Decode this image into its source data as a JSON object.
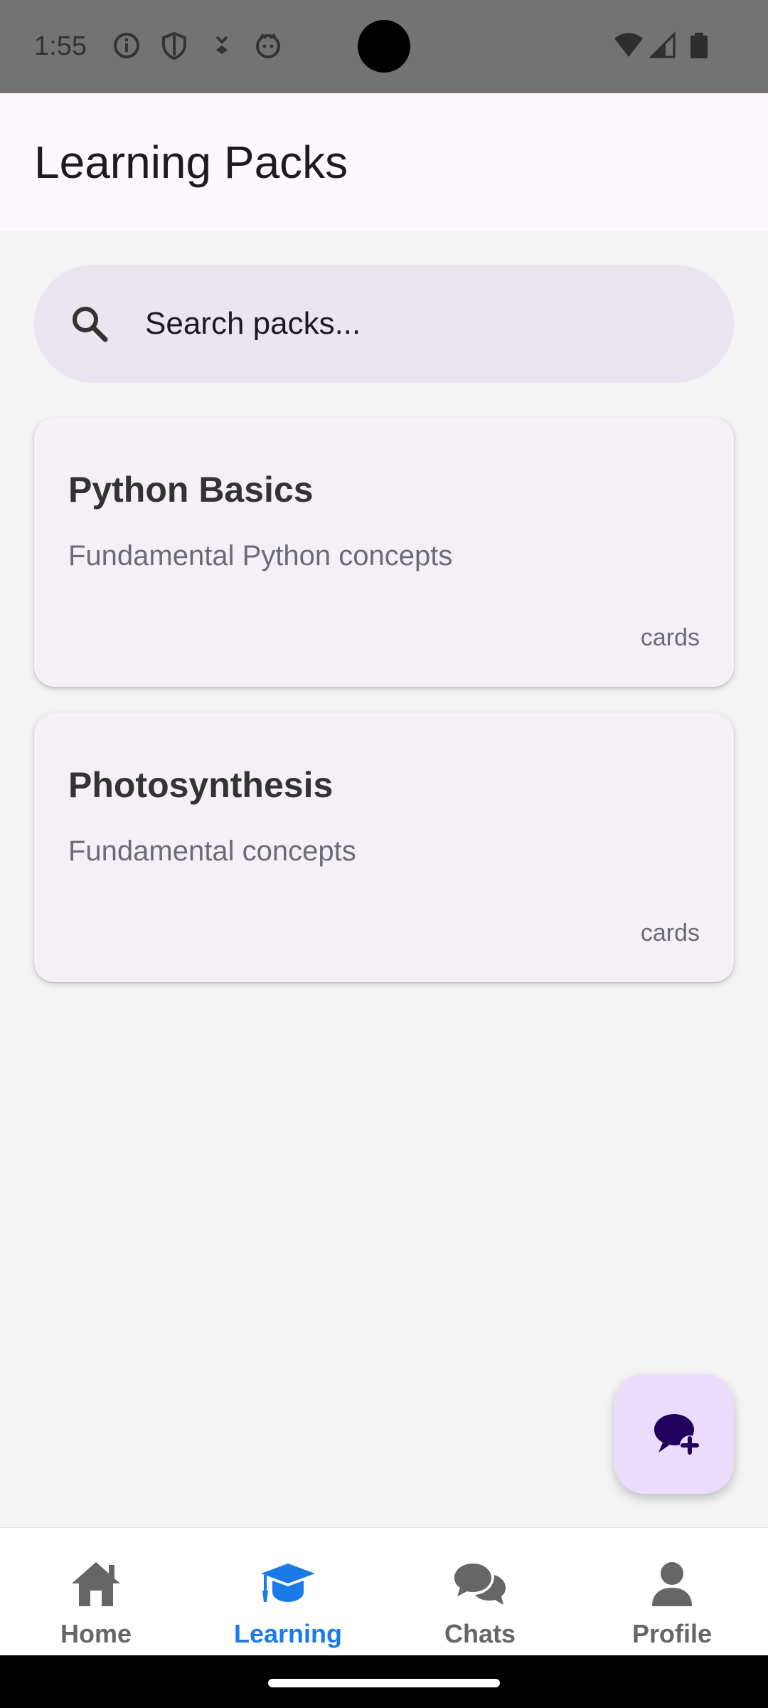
{
  "status_bar": {
    "time": "1:55",
    "left_icons": [
      "info-icon",
      "shield-icon",
      "download-icon",
      "cat-icon"
    ],
    "right_icons": [
      "wifi-icon",
      "signal-icon",
      "battery-icon"
    ]
  },
  "app_bar": {
    "title": "Learning Packs"
  },
  "search": {
    "placeholder": "Search packs...",
    "value": ""
  },
  "packs": [
    {
      "title": "Python Basics",
      "description": "Fundamental Python concepts",
      "count": "cards"
    },
    {
      "title": "Photosynthesis",
      "description": "Fundamental concepts",
      "count": "cards"
    }
  ],
  "fab": {
    "icon": "new-chat-icon"
  },
  "bottom_nav": {
    "items": [
      {
        "label": "Home",
        "icon": "home-icon",
        "active": false
      },
      {
        "label": "Learning",
        "icon": "graduation-cap-icon",
        "active": true
      },
      {
        "label": "Chats",
        "icon": "chat-bubbles-icon",
        "active": false
      },
      {
        "label": "Profile",
        "icon": "person-icon",
        "active": false
      }
    ]
  },
  "colors": {
    "accent": "#1a7be8",
    "app_bar_bg": "#fef7fe",
    "search_bg": "#ebe5ef",
    "card_bg": "#f4f0f6",
    "fab_bg": "#eadcfd",
    "fab_icon": "#21005d"
  }
}
